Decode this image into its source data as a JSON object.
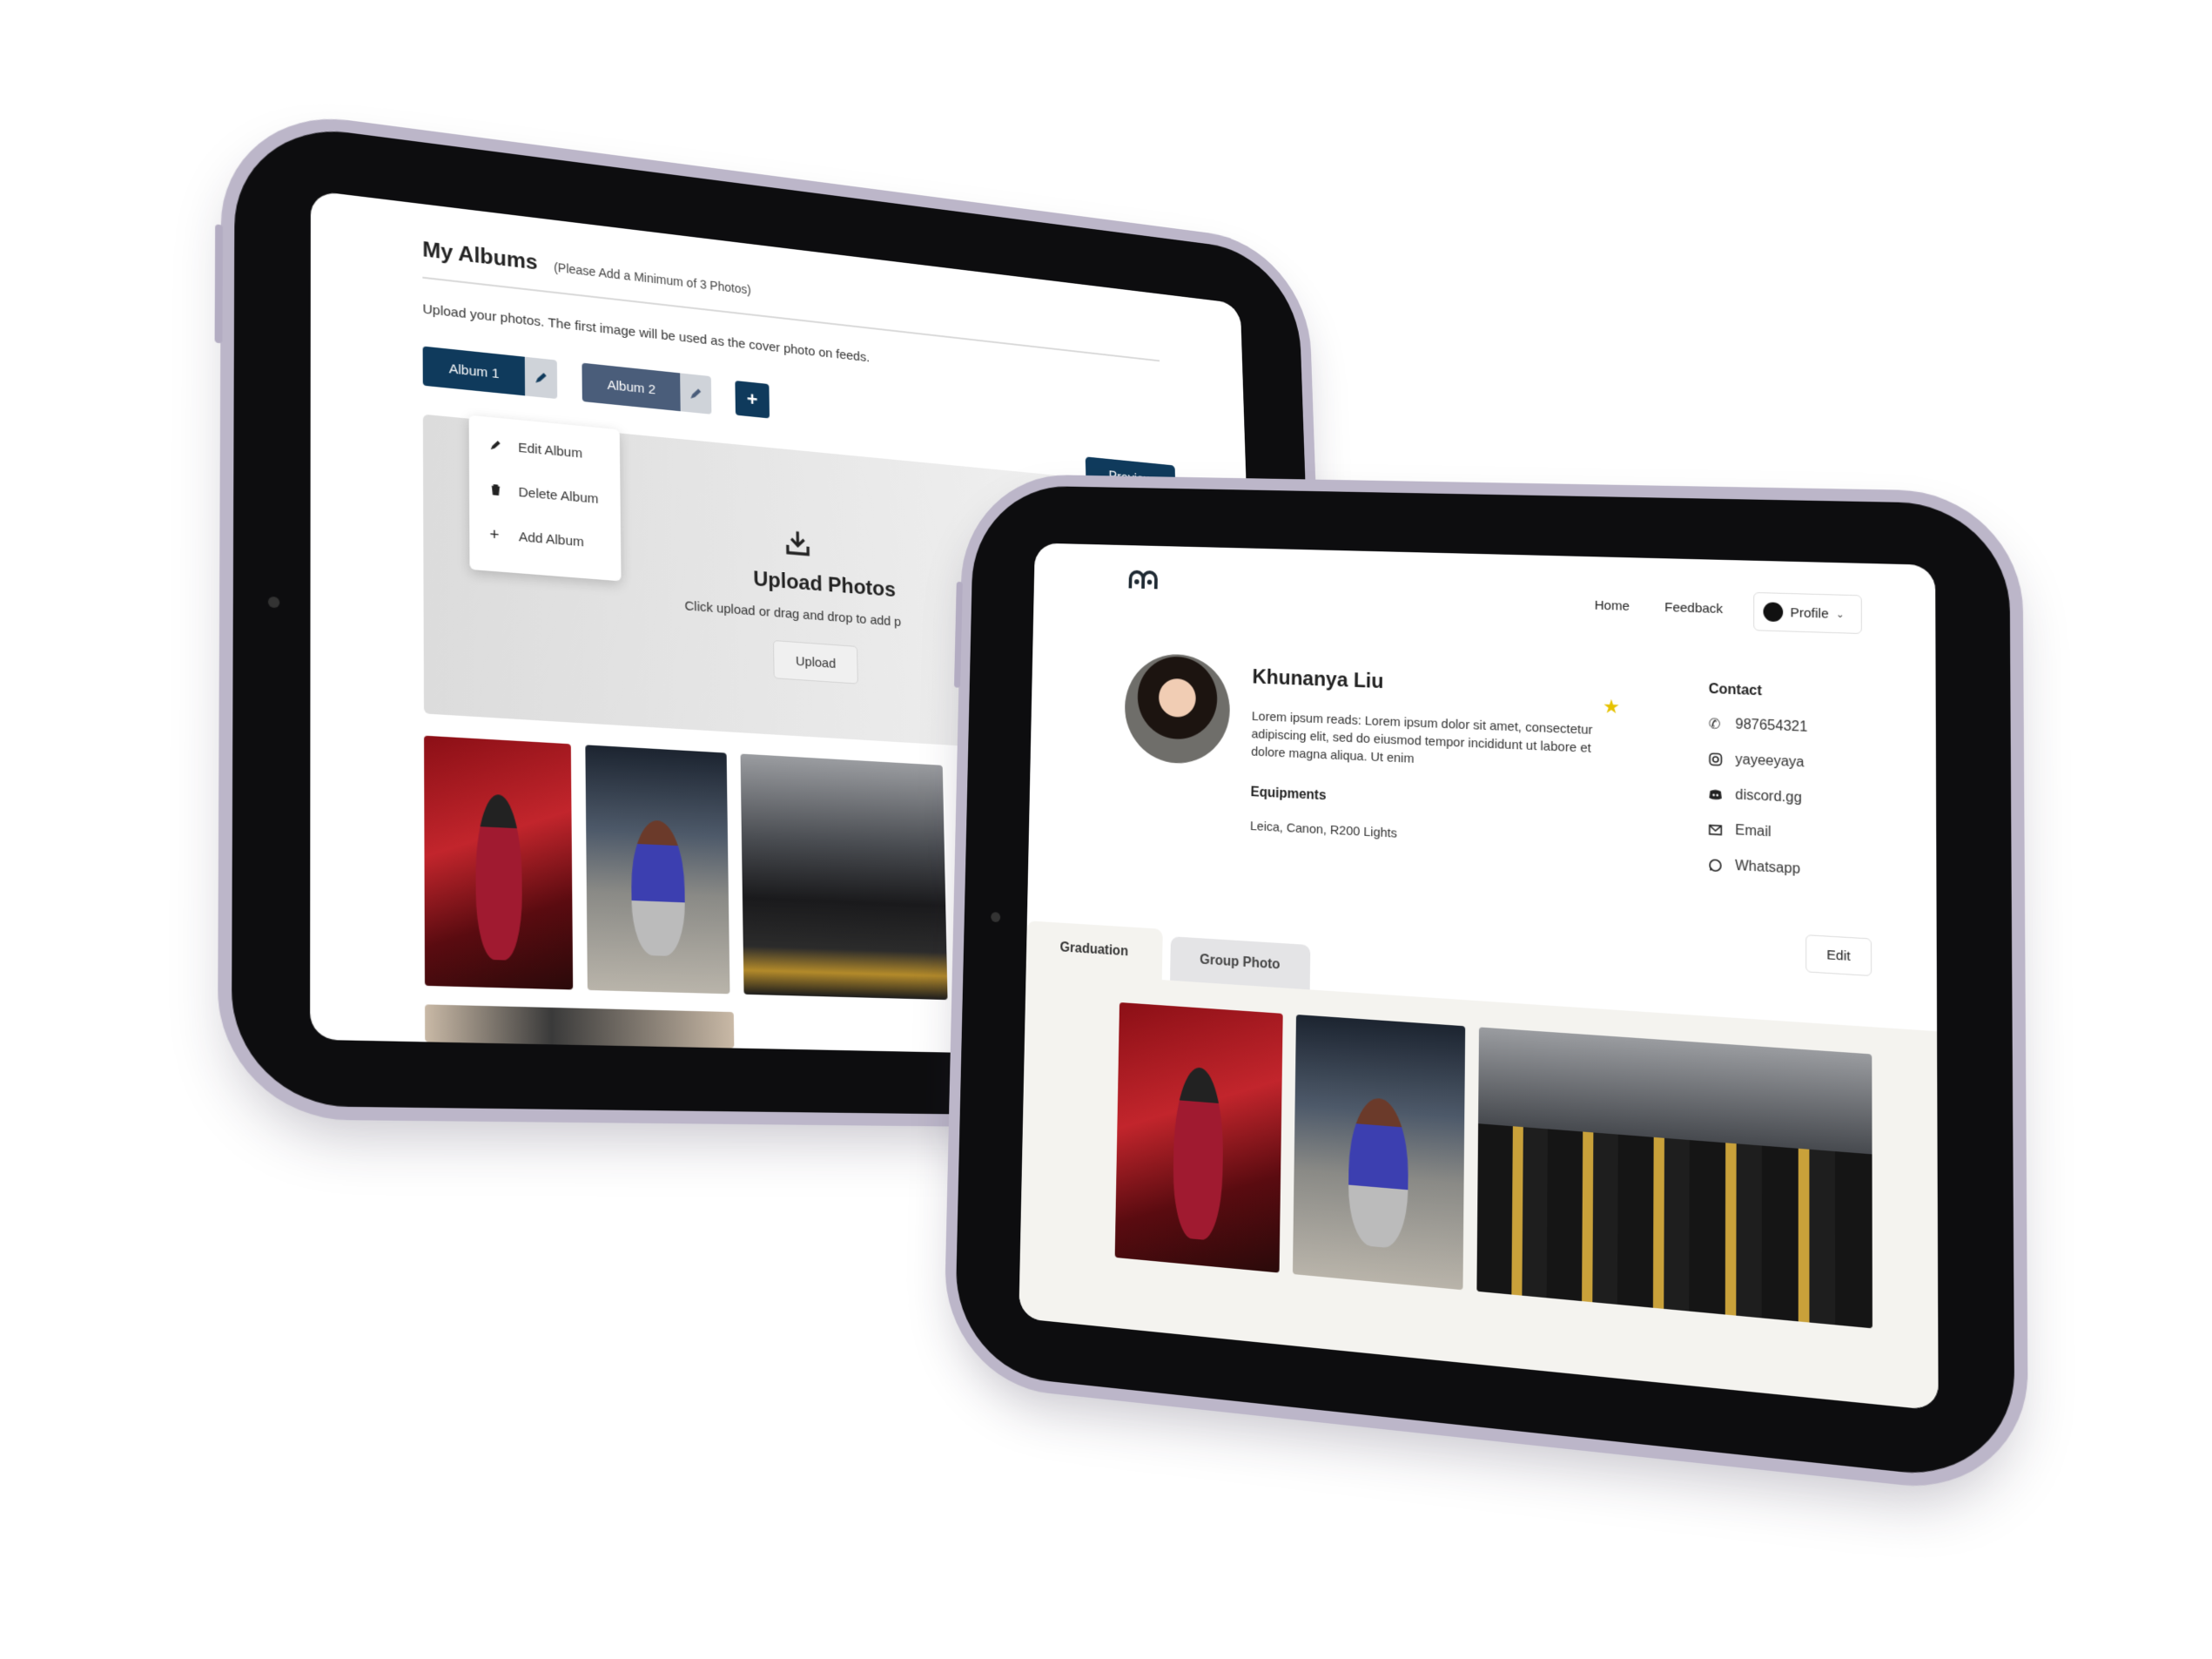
{
  "back": {
    "title": "My Albums",
    "title_note": "(Please Add a Minimum of 3 Photos)",
    "instructions": "Upload your photos. The first image will be used as the cover photo on feeds.",
    "albums": [
      {
        "label": "Album 1",
        "edit_icon": "pencil-icon"
      },
      {
        "label": "Album 2",
        "edit_icon": "pencil-icon"
      }
    ],
    "add_album_symbol": "+",
    "preview_label": "Preview",
    "menu": [
      {
        "icon": "pencil-icon",
        "label": "Edit Album"
      },
      {
        "icon": "trash-icon",
        "label": "Delete Album"
      },
      {
        "icon": "plus-icon",
        "label": "Add Album"
      }
    ],
    "upload": {
      "icon": "download-tray-icon",
      "title": "Upload Photos",
      "subtitle": "Click upload or drag and drop to add p",
      "button": "Upload"
    }
  },
  "front": {
    "nav": {
      "home": "Home",
      "feedback": "Feedback",
      "profile": "Profile"
    },
    "profile": {
      "name": "Khunanya Liu",
      "bio": "Lorem ipsum reads: Lorem ipsum dolor sit amet, consectetur adipiscing elit, sed do eiusmod tempor incididunt ut labore et dolore magna aliqua. Ut enim",
      "equipments_title": "Equipments",
      "equipments": "Leica, Canon, R200 Lights"
    },
    "contact": {
      "title": "Contact",
      "items": [
        {
          "icon": "phone-icon",
          "label": "987654321"
        },
        {
          "icon": "instagram-icon",
          "label": "yayeeyaya"
        },
        {
          "icon": "discord-icon",
          "label": "discord.gg"
        },
        {
          "icon": "mail-icon",
          "label": "Email"
        },
        {
          "icon": "whatsapp-icon",
          "label": "Whatsapp"
        }
      ]
    },
    "edit_label": "Edit",
    "tabs": [
      {
        "label": "Graduation",
        "active": true
      },
      {
        "label": "Group Photo",
        "active": false
      }
    ]
  },
  "colors": {
    "navy": "#0f3a5c",
    "slate": "#4a5d7a",
    "device_frame": "#bcb6c9",
    "star": "#e6c200"
  }
}
